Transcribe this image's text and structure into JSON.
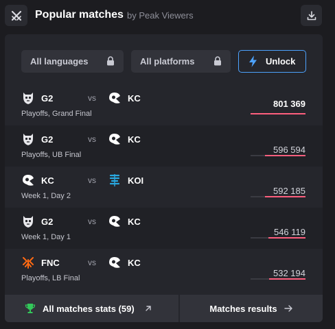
{
  "header": {
    "title": "Popular matches",
    "subtitle": "by Peak Viewers",
    "logo_icon": "crossed-swords-icon",
    "download_icon": "download-icon"
  },
  "filters": {
    "languages_label": "All languages",
    "platforms_label": "All platforms",
    "unlock_label": "Unlock",
    "accent": "#4da3ff"
  },
  "matches": [
    {
      "team1": "G2",
      "team2": "KC",
      "vs": "vs",
      "stage": "Playoffs, Grand Final",
      "viewers": "801 369",
      "share": 1.0
    },
    {
      "team1": "G2",
      "team2": "KC",
      "vs": "vs",
      "stage": "Playoffs, UB Final",
      "viewers": "596 594",
      "share": 0.74
    },
    {
      "team1": "KC",
      "team2": "KOI",
      "vs": "vs",
      "stage": "Week 1, Day 2",
      "viewers": "592 185",
      "share": 0.74
    },
    {
      "team1": "G2",
      "team2": "KC",
      "vs": "vs",
      "stage": "Week 1, Day 1",
      "viewers": "546 119",
      "share": 0.68
    },
    {
      "team1": "FNC",
      "team2": "KC",
      "vs": "vs",
      "stage": "Playoffs, LB Final",
      "viewers": "532 194",
      "share": 0.66
    }
  ],
  "footer": {
    "stats_label": "All matches stats (59)",
    "results_label": "Matches results"
  },
  "colors": {
    "bar_fill": "#ff5f7e",
    "trophy": "#33c85a",
    "kc_logo": "#ffffff",
    "koi_logo": "#29a8e0",
    "fnc_logo": "#ff6a13"
  }
}
